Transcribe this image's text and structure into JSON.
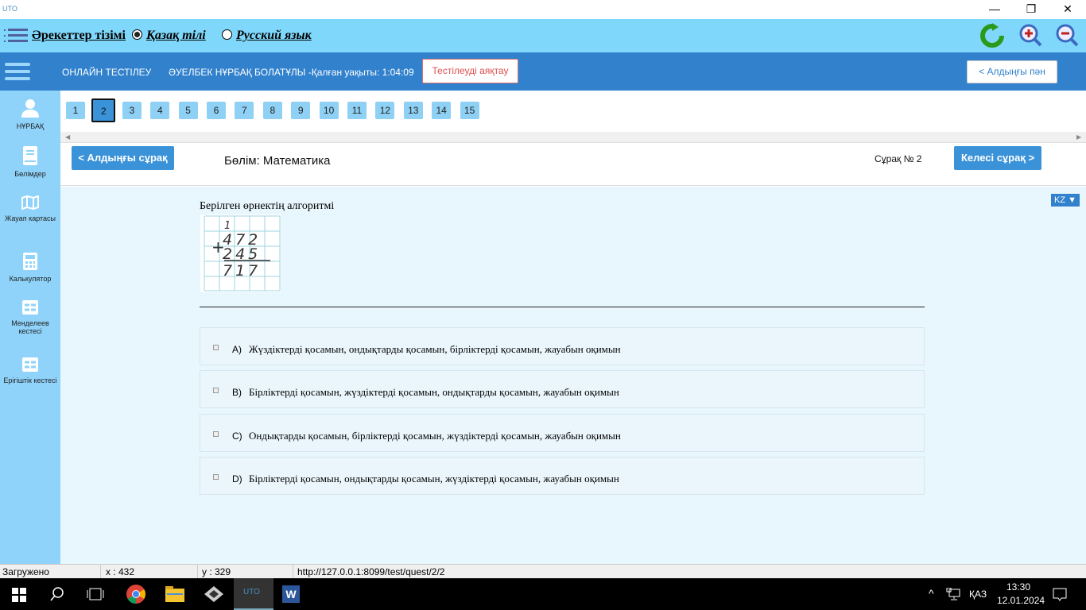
{
  "titlebar": {
    "app_logo": "UTO",
    "minimize": "—",
    "restore": "❐",
    "close": "✕"
  },
  "toolbar": {
    "actions_list": "Әрекеттер тізімі",
    "lang_kz": "Қазақ тілі",
    "lang_ru": "Русский язык",
    "lang_selected": "kz",
    "icons": [
      "refresh-icon",
      "zoom-in-icon",
      "zoom-out-icon"
    ]
  },
  "navbar": {
    "title": "ОНЛАЙН ТЕСТІЛЕУ",
    "student": "ӘУЕЛБЕК НҰРБАҚ БОЛАТҰЛЫ -Қалған уақыты: 1:04:09",
    "finish_button": "Тестілеуді аяқтау",
    "prev_subject_button": "< Алдыңғы пән"
  },
  "sidebar": {
    "items": [
      {
        "label": "НҰРБАҚ",
        "icon": "user-icon"
      },
      {
        "label": "Бөлімдер",
        "icon": "book-icon"
      },
      {
        "label": "Жауап картасы",
        "icon": "map-icon"
      },
      {
        "label": "Калькулятор",
        "icon": "calculator-icon"
      },
      {
        "label": "Менделеев кестесі",
        "icon": "table-icon"
      },
      {
        "label": "Ерігіштік кестесі",
        "icon": "table-icon"
      }
    ]
  },
  "question_numbers": [
    "1",
    "2",
    "3",
    "4",
    "5",
    "6",
    "7",
    "8",
    "9",
    "10",
    "11",
    "12",
    "13",
    "14",
    "15"
  ],
  "current_question": "2",
  "question_header": {
    "prev_button": "< Алдыңғы сұрақ",
    "section": "Бөлім: Математика",
    "question_no": "Сұрақ № 2",
    "next_button": "Келесі сұрақ >"
  },
  "lang_badge": "KZ ▼",
  "question": {
    "text": "Берілген өрнектің алгоритмі",
    "image": {
      "carry": "1",
      "row1": "472",
      "row2": "245",
      "result": "717",
      "operator": "+"
    }
  },
  "answers": [
    {
      "letter": "A)",
      "text": "Жүздіктерді қосамын, ондықтарды қосамын, бірліктерді қосамын, жауабын оқимын"
    },
    {
      "letter": "B)",
      "text": "Бірліктерді қосамын, жүздіктерді қосамын, ондықтарды қосамын, жауабын оқимын"
    },
    {
      "letter": "C)",
      "text": "Ондықтарды қосамын, бірліктерді қосамын, жүздіктерді қосамын, жауабын оқимын"
    },
    {
      "letter": "D)",
      "text": "Бірліктерді қосамын, ондықтарды қосамын, жүздіктерді қосамын, жауабын оқимын"
    }
  ],
  "status": {
    "state": "Загружено",
    "x": "x : 432",
    "y": "y : 329",
    "url": "http://127.0.0.1:8099/test/quest/2/2"
  },
  "taskbar": {
    "lang": "ҚАЗ",
    "time": "13:30",
    "date": "12.01.2024"
  }
}
